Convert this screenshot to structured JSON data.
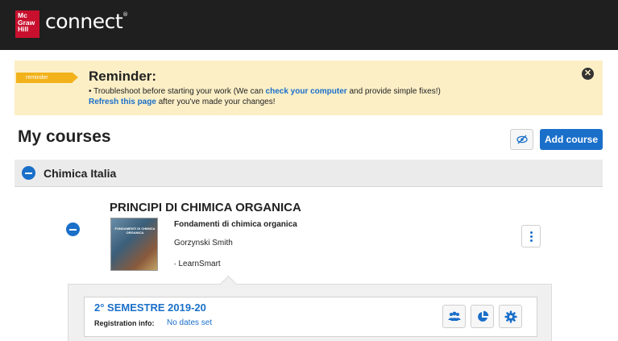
{
  "header": {
    "logo_lines": [
      "Mc",
      "Graw",
      "Hill"
    ],
    "brand": "connect",
    "brand_mark": "®"
  },
  "reminder": {
    "tag": "reminder",
    "title": "Reminder:",
    "line1_prefix": "• Troubleshoot before starting your work (We can ",
    "line1_link": "check your computer",
    "line1_suffix": " and provide simple fixes!)",
    "line2_link": "Refresh this page",
    "line2_suffix": " after you've made your changes!",
    "close_icon": "close-circle-icon"
  },
  "courses": {
    "heading": "My courses",
    "toggle_icon": "eye-slash-icon",
    "add_label": "Add course"
  },
  "group": {
    "title": "Chimica Italia"
  },
  "course": {
    "title": "PRINCIPI DI CHIMICA ORGANICA",
    "cover_text": "FONDAMENTI DI CHIMICA ORGANICA",
    "book_title": "Fondamenti di chimica organica",
    "author": "Gorzynski Smith",
    "product": "LearnSmart"
  },
  "section": {
    "title": "2° SEMESTRE 2019-20",
    "registration_label": "Registration info:",
    "registration_value": "No dates set",
    "actions": [
      "users-icon",
      "pie-chart-icon",
      "gear-icon"
    ]
  },
  "colors": {
    "accent": "#1a6fc9",
    "topbar": "#1f1f1f",
    "brand_red": "#c8102e",
    "reminder_bg": "#fcefc6",
    "reminder_tag": "#f2b21b"
  }
}
